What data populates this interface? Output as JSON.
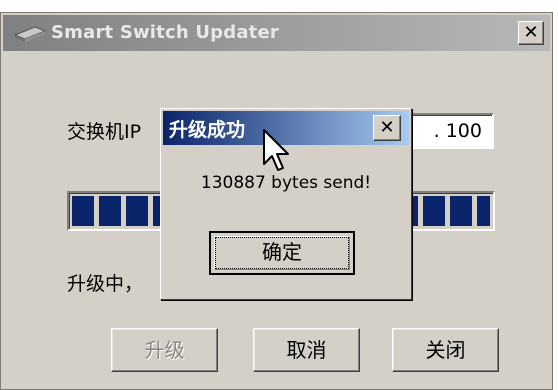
{
  "window": {
    "title": "Smart Switch Updater",
    "close_glyph": "✕",
    "icon": "network-switch-icon"
  },
  "form": {
    "ip_label": "交换机IP",
    "ip_value": ". 100"
  },
  "progress": {
    "fraction": 1.0,
    "color": "#0a246a"
  },
  "status": {
    "text": "升级中，"
  },
  "buttons": {
    "upgrade": "升级",
    "cancel": "取消",
    "close": "关闭"
  },
  "dialog": {
    "title": "升级成功",
    "close_glyph": "✕",
    "message": "130887 bytes send!",
    "ok": "确定"
  },
  "colors": {
    "face": "#d4d0c8",
    "active_title": "#0a246a",
    "inactive_title": "#808080"
  }
}
